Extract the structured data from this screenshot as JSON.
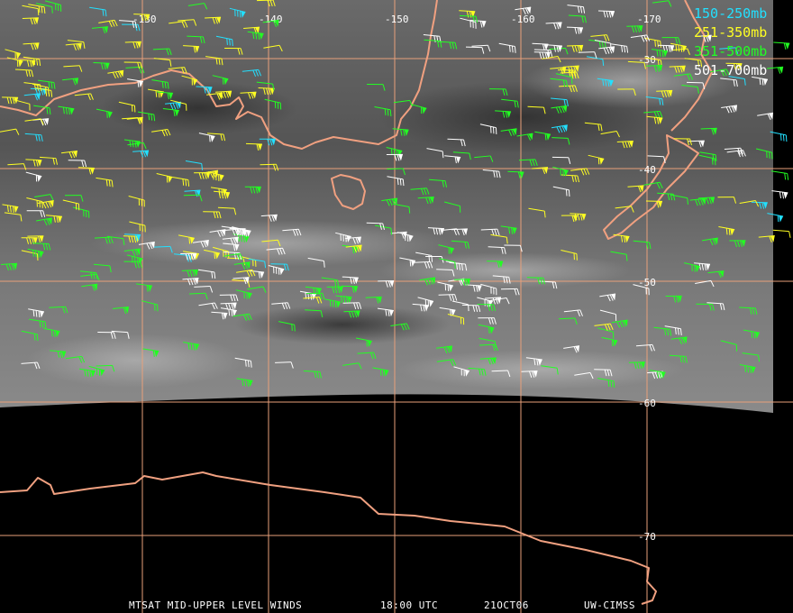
{
  "title_bar": {
    "product": "MTSAT MID-UPPER LEVEL WINDS",
    "time": "18:00 UTC",
    "date": "21OCT06",
    "source": "UW-CIMSS"
  },
  "grid": {
    "longitude_labels": [
      "-130",
      "-140",
      "-150",
      "-160",
      "-170"
    ],
    "latitude_labels": [
      "-30",
      "-40",
      "-50",
      "-60",
      "-70"
    ]
  },
  "legend": [
    {
      "label": "150-250mb",
      "color": "#22e0ff"
    },
    {
      "label": "251-350mb",
      "color": "#ffff22"
    },
    {
      "label": "351-500mb",
      "color": "#22ff22"
    },
    {
      "label": "501-700mb",
      "color": "#ffffff"
    }
  ],
  "colors": {
    "grid_line": "#e8a07a",
    "coastline": "#f0a080",
    "background": "#000000"
  }
}
